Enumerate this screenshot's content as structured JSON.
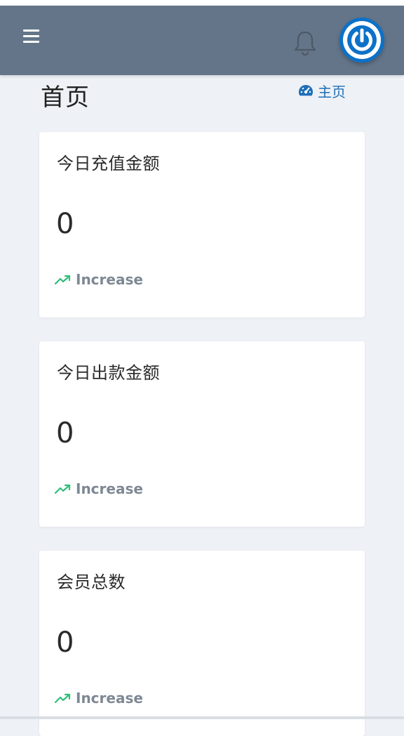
{
  "header": {
    "menu_icon": "hamburger-menu-icon",
    "bell_icon": "bell-icon",
    "avatar_icon": "power-icon"
  },
  "page": {
    "title": "首页",
    "breadcrumb_icon": "dashboard-gauge-icon",
    "breadcrumb": "主页"
  },
  "cards": [
    {
      "title": "今日充值金额",
      "value": "0",
      "trend_label": "Increase",
      "trend_icon": "trending-up-icon"
    },
    {
      "title": "今日出款金额",
      "value": "0",
      "trend_label": "Increase",
      "trend_icon": "trending-up-icon"
    },
    {
      "title": "会员总数",
      "value": "0",
      "trend_label": "Increase",
      "trend_icon": "trending-up-icon"
    }
  ],
  "colors": {
    "topbar": "#647589",
    "background": "#eef1f6",
    "accent_blue": "#0c71c8",
    "link_blue": "#1f6fb7",
    "trend_green": "#2ebf7a",
    "muted_gray": "#7e8894"
  }
}
